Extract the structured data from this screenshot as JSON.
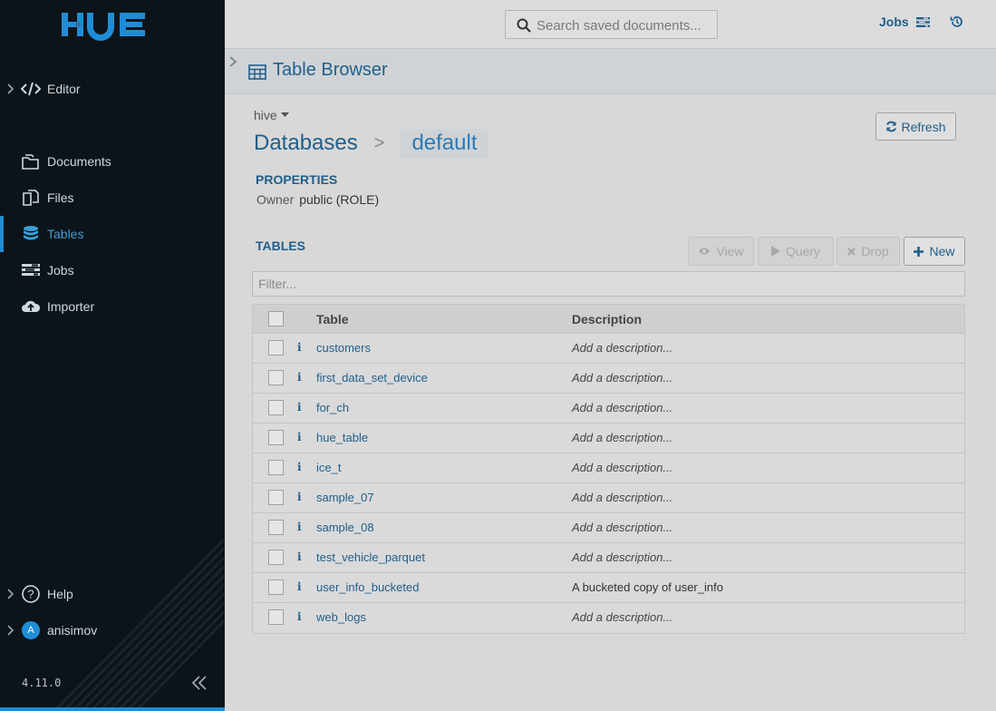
{
  "brand": {
    "logo_text": "HUE"
  },
  "sidebar": {
    "editor": "Editor",
    "items": [
      {
        "label": "Documents",
        "icon": "documents-icon"
      },
      {
        "label": "Files",
        "icon": "files-icon"
      },
      {
        "label": "Tables",
        "icon": "database-icon",
        "active": true
      },
      {
        "label": "Jobs",
        "icon": "jobs-icon"
      },
      {
        "label": "Importer",
        "icon": "cloud-upload-icon"
      }
    ],
    "help": "Help",
    "user": {
      "name": "anisimov",
      "initial": "A"
    },
    "version": "4.11.0"
  },
  "topbar": {
    "search_placeholder": "Search saved documents...",
    "jobs_label": "Jobs"
  },
  "subheader": {
    "title": "Table Browser"
  },
  "main": {
    "source": "hive",
    "breadcrumb_root": "Databases",
    "breadcrumb_sep": ">",
    "breadcrumb_current": "default",
    "refresh_label": "Refresh",
    "properties_heading": "PROPERTIES",
    "owner_key": "Owner",
    "owner_value": "public (ROLE)",
    "tables_heading": "TABLES",
    "actions": {
      "view": "View",
      "query": "Query",
      "drop": "Drop",
      "new": "New"
    },
    "filter_placeholder": "Filter...",
    "columns": {
      "table": "Table",
      "description": "Description"
    },
    "rows": [
      {
        "name": "customers",
        "description": "Add a description..."
      },
      {
        "name": "first_data_set_device",
        "description": "Add a description..."
      },
      {
        "name": "for_ch",
        "description": "Add a description..."
      },
      {
        "name": "hue_table",
        "description": "Add a description..."
      },
      {
        "name": "ice_t",
        "description": "Add a description..."
      },
      {
        "name": "sample_07",
        "description": "Add a description..."
      },
      {
        "name": "sample_08",
        "description": "Add a description..."
      },
      {
        "name": "test_vehicle_parquet",
        "description": "Add a description..."
      },
      {
        "name": "user_info_bucketed",
        "description": "A bucketed copy of user_info",
        "set": true
      },
      {
        "name": "web_logs",
        "description": "Add a description..."
      }
    ]
  },
  "colors": {
    "accent": "#1f8dd6",
    "link": "#1f5f8b",
    "sidebar_bg": "#0d1419"
  }
}
